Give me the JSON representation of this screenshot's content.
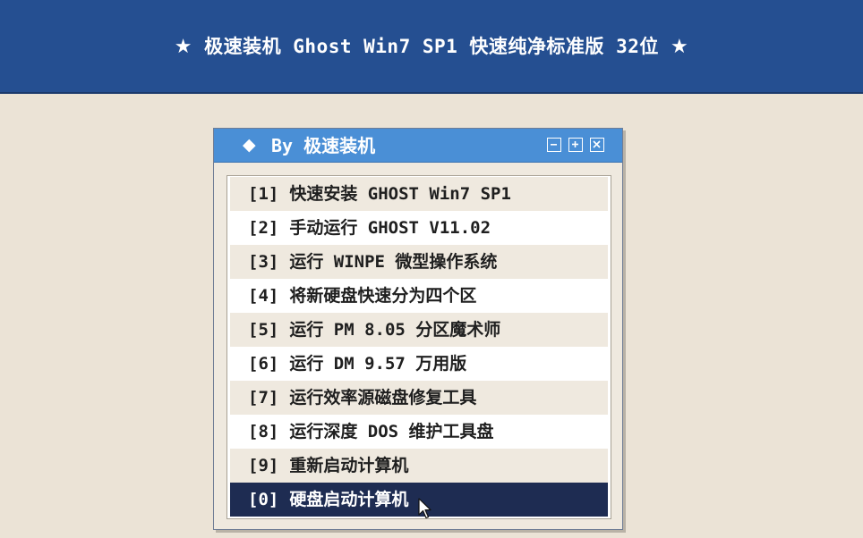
{
  "banner": {
    "title": "极速装机 Ghost Win7 SP1 快速纯净标准版 32位",
    "star_left": "★",
    "star_right": "★"
  },
  "window": {
    "title": "By 极速装机",
    "title_icon": "diamond-icon",
    "buttons": [
      "minimize-icon",
      "maximize-icon",
      "close-icon"
    ]
  },
  "menu": {
    "items": [
      {
        "key": "[1]",
        "label": "快速安装 GHOST Win7 SP1"
      },
      {
        "key": "[2]",
        "label": "手动运行 GHOST V11.02"
      },
      {
        "key": "[3]",
        "label": "运行 WINPE 微型操作系统"
      },
      {
        "key": "[4]",
        "label": "将新硬盘快速分为四个区"
      },
      {
        "key": "[5]",
        "label": "运行 PM 8.05 分区魔术师"
      },
      {
        "key": "[6]",
        "label": "运行 DM 9.57 万用版"
      },
      {
        "key": "[7]",
        "label": "运行效率源磁盘修复工具"
      },
      {
        "key": "[8]",
        "label": "运行深度 DOS 维护工具盘"
      },
      {
        "key": "[9]",
        "label": "重新启动计算机"
      },
      {
        "key": "[0]",
        "label": "硬盘启动计算机"
      }
    ],
    "selected_index": 9
  },
  "colors": {
    "banner_bg": "#254f91",
    "titlebar_bg": "#4a8fd6",
    "selected_bg": "#1e2c52",
    "page_bg": "#ebe3d6"
  }
}
